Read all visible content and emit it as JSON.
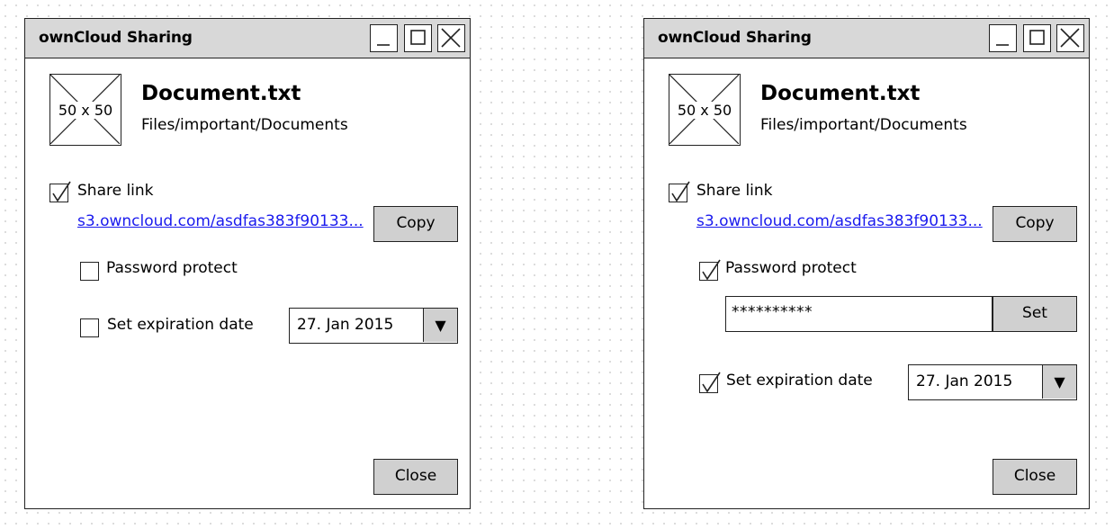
{
  "dialogs": [
    {
      "title": "ownCloud Sharing",
      "thumbnail_label": "50 x 50",
      "file_name": "Document.txt",
      "file_path": "Files/important/Documents",
      "share_link": {
        "label": "Share link",
        "checked": true,
        "url": "s3.owncloud.com/asdfas383f90133..."
      },
      "copy_label": "Copy",
      "password_protect": {
        "label": "Password protect",
        "checked": false
      },
      "expiration": {
        "label": "Set expiration date",
        "checked": false,
        "date": "27. Jan 2015"
      },
      "close_label": "Close"
    },
    {
      "title": "ownCloud Sharing",
      "thumbnail_label": "50 x 50",
      "file_name": "Document.txt",
      "file_path": "Files/important/Documents",
      "share_link": {
        "label": "Share link",
        "checked": true,
        "url": "s3.owncloud.com/asdfas383f90133..."
      },
      "copy_label": "Copy",
      "password_protect": {
        "label": "Password protect",
        "checked": true,
        "value": "**********",
        "set_label": "Set"
      },
      "expiration": {
        "label": "Set expiration date",
        "checked": true,
        "date": "27. Jan 2015"
      },
      "close_label": "Close"
    }
  ],
  "icons": {
    "minimize": "minimize-icon",
    "maximize": "maximize-icon",
    "close": "close-icon",
    "checkmark": "checkmark-icon",
    "dropdown": "chevron-down-icon"
  },
  "dropdown_glyph": "▼"
}
